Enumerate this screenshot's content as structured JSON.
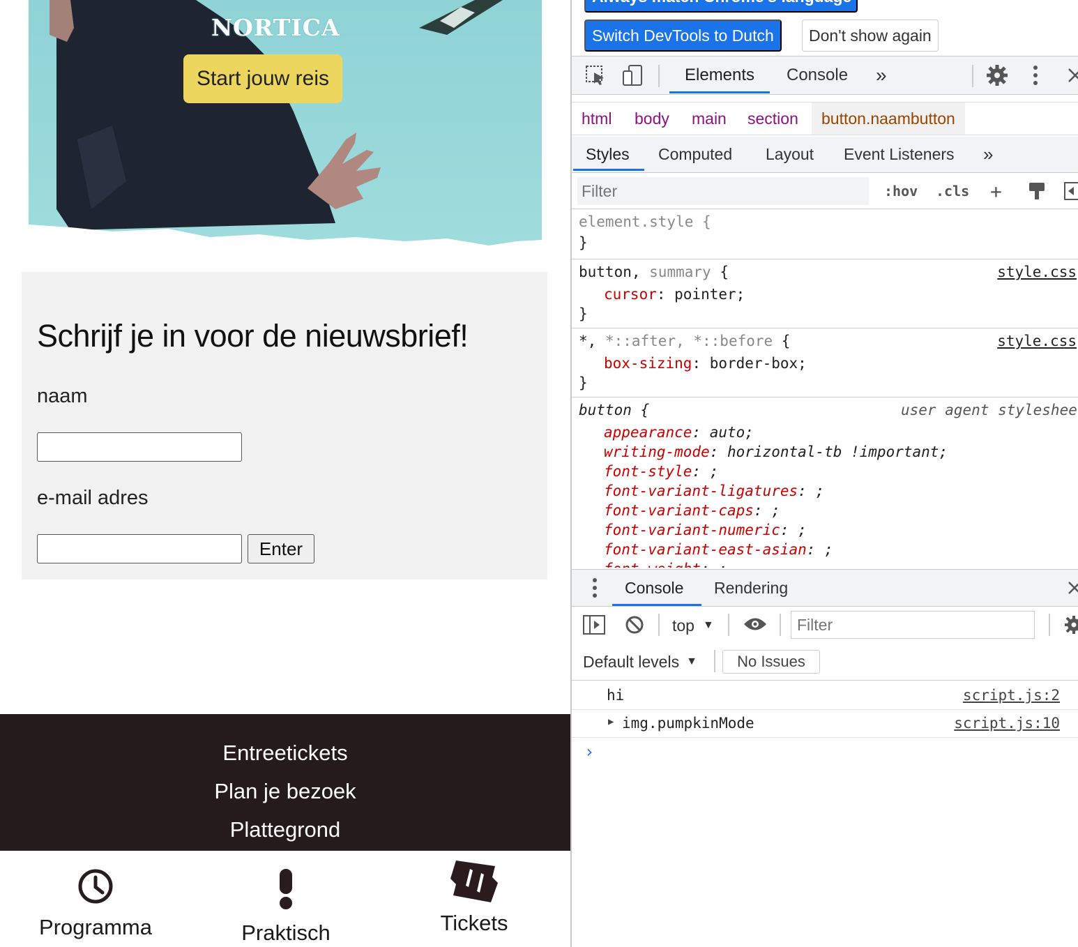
{
  "site": {
    "hero": {
      "title": "NORTICA",
      "start_button": "Start jouw reis"
    },
    "newsletter": {
      "title": "Schrijf je in voor de nieuwsbrief!",
      "name_label": "naam",
      "name_value": "",
      "email_label": "e-mail adres",
      "email_value": "",
      "enter_button": "Enter"
    },
    "footer": {
      "links": [
        "Entreetickets",
        "Plan je bezoek",
        "Plattegrond"
      ]
    },
    "tabbar": {
      "programma": "Programma",
      "praktisch": "Praktisch",
      "tickets": "Tickets"
    }
  },
  "devtools": {
    "infobar": {
      "match_button": "Always match Chrome's language",
      "switch_button": "Switch DevTools to Dutch",
      "dont_show_button": "Don't show again"
    },
    "toolbar": {
      "elements_tab": "Elements",
      "console_tab": "Console",
      "more": "»"
    },
    "breadcrumbs": [
      "html",
      "body",
      "main",
      "section",
      "button.naambutton"
    ],
    "subtabs": {
      "styles": "Styles",
      "computed": "Computed",
      "layout": "Layout",
      "event_listeners": "Event Listeners",
      "more": "»"
    },
    "filter": {
      "placeholder": "Filter",
      "hov": ":hov",
      "cls": ".cls",
      "plus": "+"
    },
    "rules": {
      "element_style": "element.style {",
      "close": "}",
      "r1_selector_a": "button, ",
      "r1_selector_b": "summary",
      "r1_open": " {",
      "r1_source": "style.css",
      "r1_prop": "cursor",
      "r1_value": ": pointer;",
      "r2_selector_a": "*, ",
      "r2_selector_b": "*::after, *::before",
      "r2_open": " {",
      "r2_source": "style.css",
      "r2_prop": "box-sizing",
      "r2_value": ": border-box;",
      "ua_selector": "button {",
      "ua_source": "user agent stylesheet",
      "ua_props": [
        {
          "prop": "appearance",
          "value": ": auto;"
        },
        {
          "prop": "writing-mode",
          "value": ": horizontal-tb !important;"
        },
        {
          "prop": "font-style",
          "value": ": ;"
        },
        {
          "prop": "font-variant-ligatures",
          "value": ": ;"
        },
        {
          "prop": "font-variant-caps",
          "value": ": ;"
        },
        {
          "prop": "font-variant-numeric",
          "value": ": ;"
        },
        {
          "prop": "font-variant-east-asian",
          "value": ": ;"
        },
        {
          "prop": "font-weight",
          "value": ": ;"
        }
      ]
    },
    "drawer": {
      "console_tab": "Console",
      "rendering_tab": "Rendering",
      "context": "top",
      "filter_placeholder": "Filter",
      "levels": "Default levels",
      "issues": "No Issues"
    },
    "console_logs": [
      {
        "message": "hi",
        "source": "script.js:2"
      },
      {
        "message": "img.pumpkinMode",
        "source": "script.js:10"
      }
    ],
    "prompt": "›"
  },
  "colors": {
    "accent_blue": "#1a73e8",
    "start_button_yellow": "#ecd65e",
    "footer_brown": "#261b1b",
    "css_property_red": "#c80000",
    "breadcrumb_purple": "#881280"
  }
}
